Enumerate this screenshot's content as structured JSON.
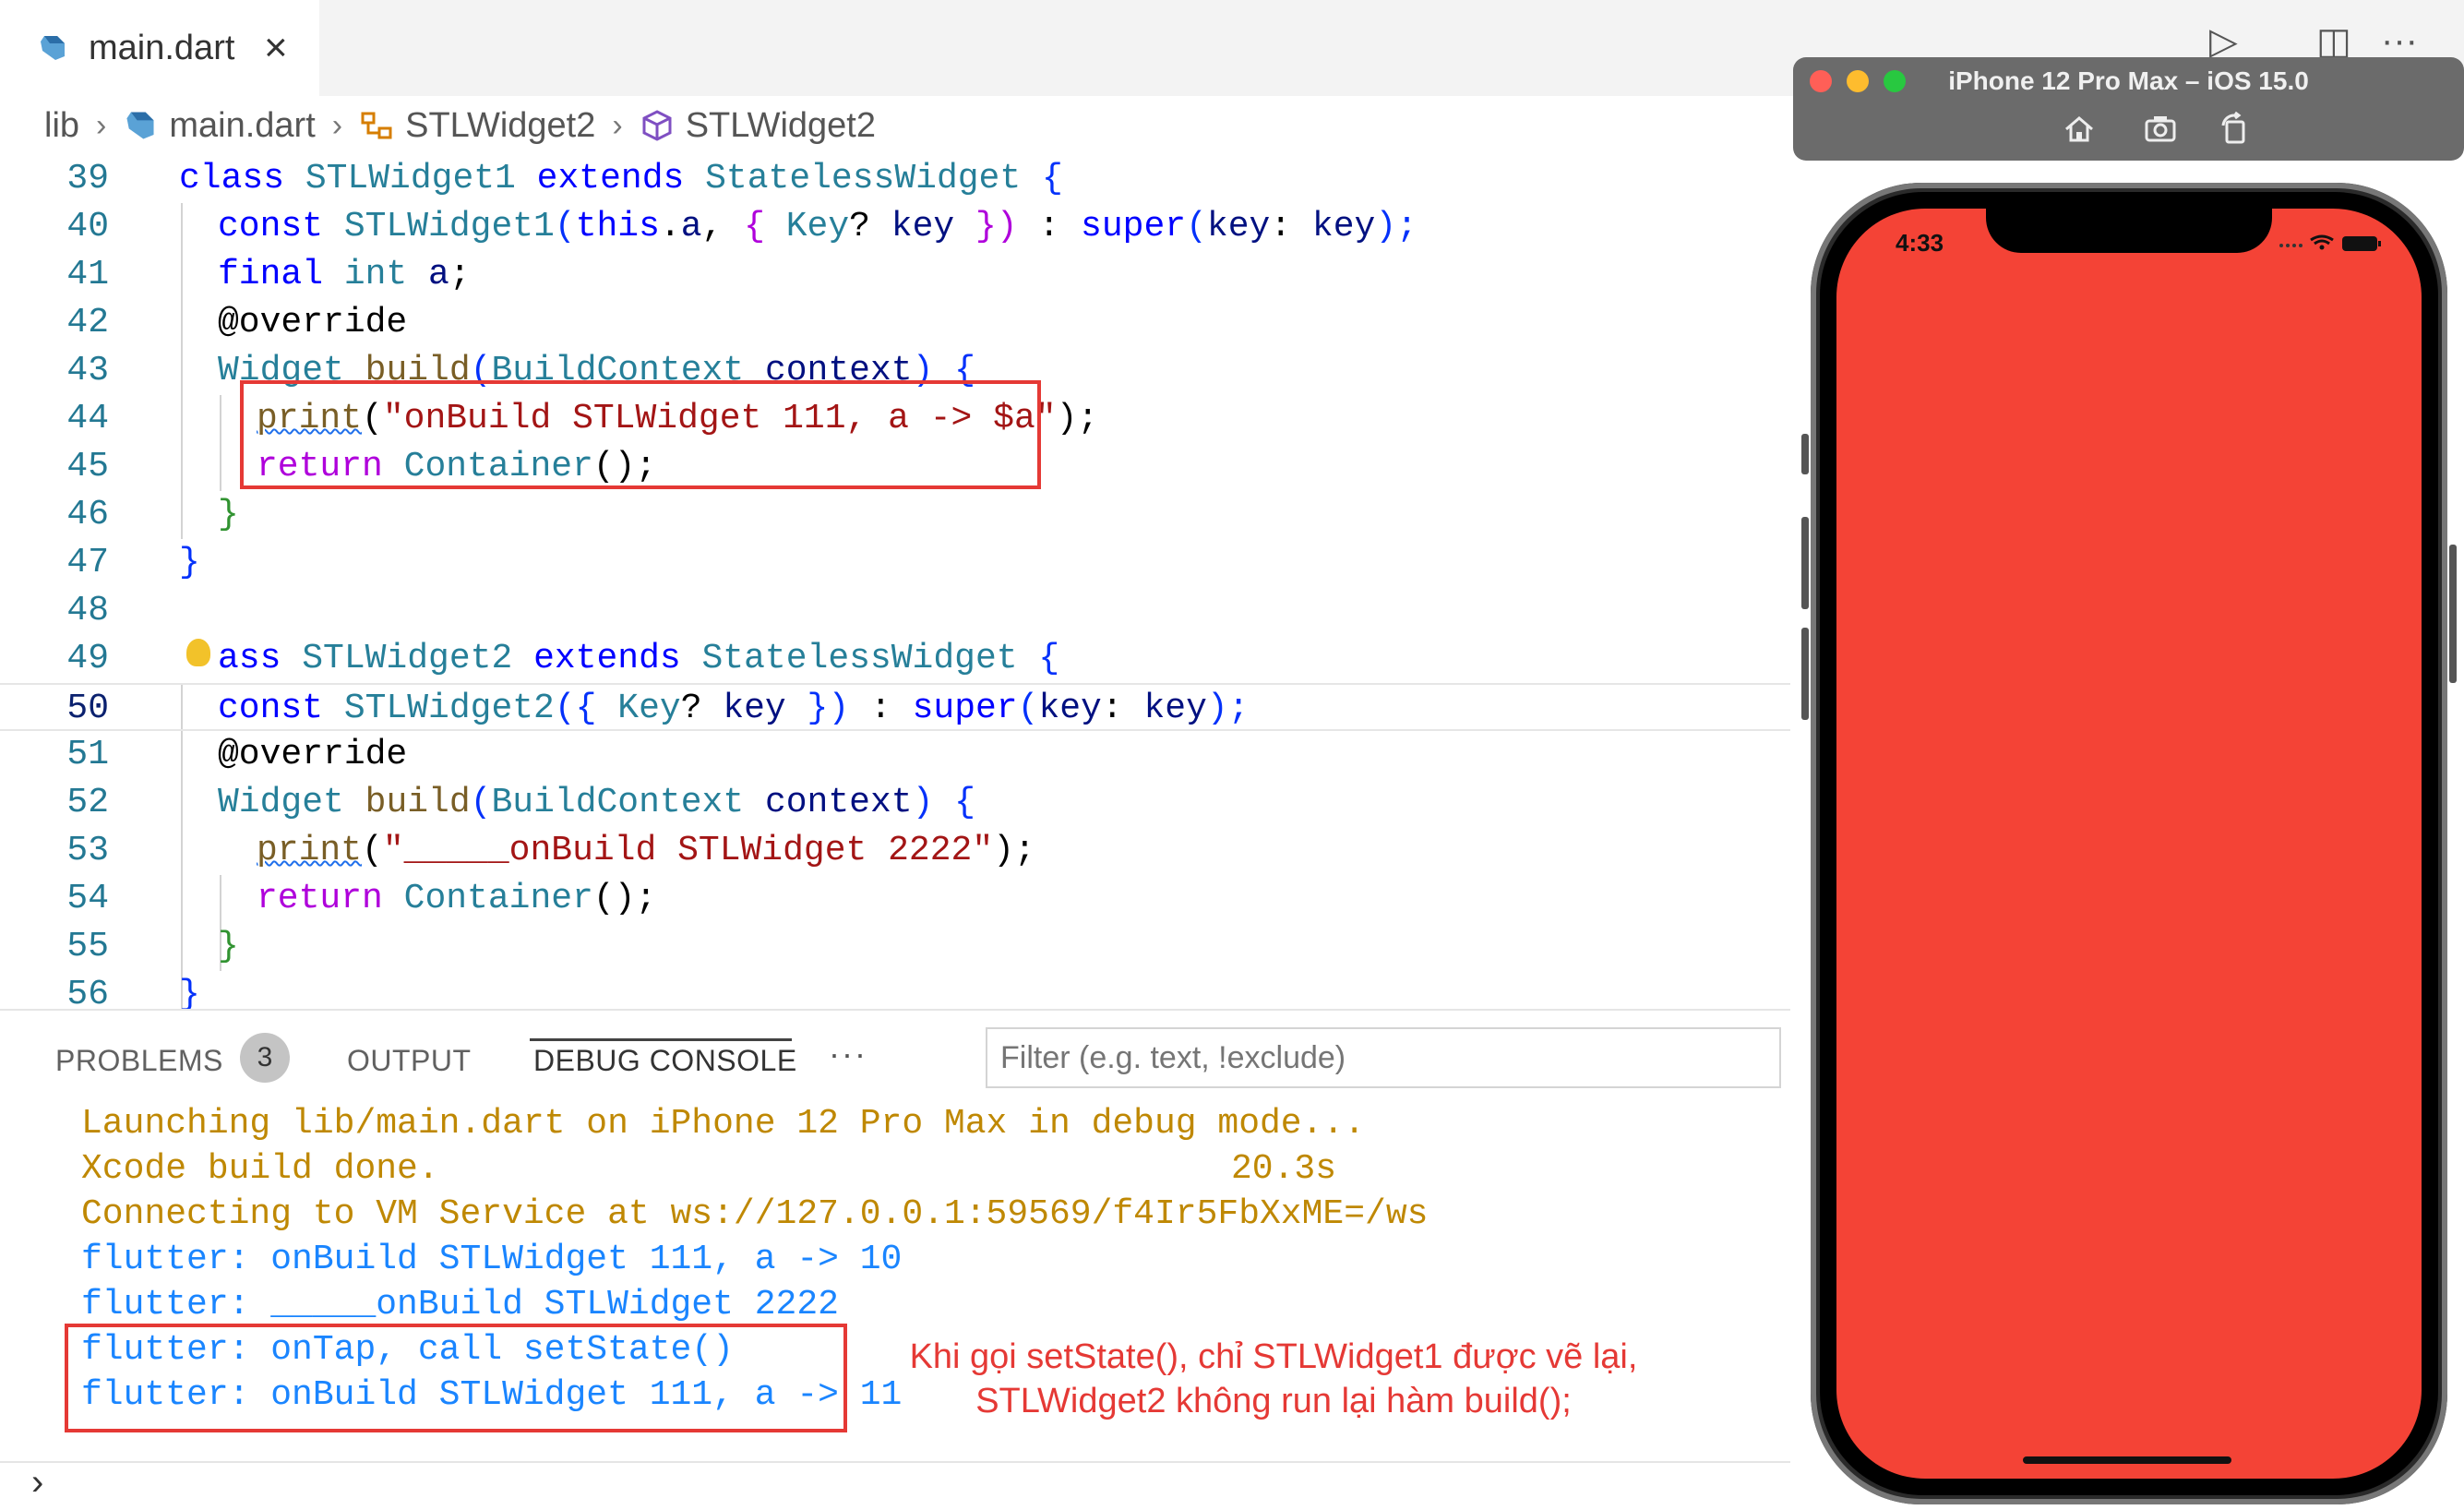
{
  "tab": {
    "label": "main.dart",
    "close": "×"
  },
  "top_actions": {
    "run": "▷",
    "split": "◫",
    "more": "···"
  },
  "breadcrumb": {
    "items": [
      "lib",
      "main.dart",
      "STLWidget2",
      "STLWidget2"
    ],
    "sep": "›"
  },
  "editor": {
    "line_numbers": [
      "39",
      "40",
      "41",
      "42",
      "43",
      "44",
      "45",
      "46",
      "47",
      "48",
      "49",
      "50",
      "51",
      "52",
      "53",
      "54",
      "55",
      "56"
    ],
    "current_line": "50",
    "lines": {
      "l39": {
        "a": "class ",
        "b": "STLWidget1",
        "c": " extends ",
        "d": "StatelessWidget",
        "e": " {"
      },
      "l40": {
        "a": "const ",
        "b": "STLWidget1",
        "c": "(",
        "d": "this",
        "e": ".",
        "f": "a",
        "g": ", ",
        "h": "{ ",
        "i": "Key",
        "j": "? ",
        "k": "key",
        "l": " })",
        "m": " : ",
        "n": "super",
        "o": "(",
        "p": "key",
        "q": ": ",
        "r": "key",
        "s": ");"
      },
      "l41": {
        "a": "final ",
        "b": "int ",
        "c": "a",
        "d": ";"
      },
      "l42": {
        "a": "@override"
      },
      "l43": {
        "a": "Widget ",
        "b": "build",
        "c": "(",
        "d": "BuildContext ",
        "e": "context",
        "f": ") {"
      },
      "l44": {
        "a": "print",
        "b": "(",
        "c": "\"onBuild STLWidget 111, a -> $a\"",
        "d": ");"
      },
      "l45": {
        "a": "return ",
        "b": "Container",
        "c": "();"
      },
      "l46": {
        "a": "}"
      },
      "l47": {
        "a": "}"
      },
      "l49": {
        "a": "ass ",
        "b": "STLWidget2",
        "c": " extends ",
        "d": "StatelessWidget",
        "e": " {"
      },
      "l50": {
        "a": "const ",
        "b": "STLWidget2",
        "c": "({ ",
        "d": "Key",
        "e": "? ",
        "f": "key",
        "g": " })",
        "h": " : ",
        "i": "super",
        "j": "(",
        "k": "key",
        "l": ": ",
        "m": "key",
        "n": ");"
      },
      "l51": {
        "a": "@override"
      },
      "l52": {
        "a": "Widget ",
        "b": "build",
        "c": "(",
        "d": "BuildContext ",
        "e": "context",
        "f": ") {"
      },
      "l53": {
        "a": "print",
        "b": "(",
        "c": "\"_____onBuild STLWidget 2222\"",
        "d": ");"
      },
      "l54": {
        "a": "return ",
        "b": "Container",
        "c": "();"
      },
      "l55": {
        "a": "}"
      },
      "l56": {
        "a": "}"
      }
    }
  },
  "panel": {
    "tabs": [
      "PROBLEMS",
      "OUTPUT",
      "DEBUG CONSOLE"
    ],
    "problems_count": "3",
    "more": "···",
    "filter_placeholder": "Filter (e.g. text, !exclude)",
    "console": [
      "Launching lib/main.dart on iPhone 12 Pro Max in debug mode...",
      "Xcode build done.",
      "20.3s",
      "Connecting to VM Service at ws://127.0.0.1:59569/f4Ir5FbXxME=/ws",
      "flutter: onBuild STLWidget 111, a -> 10",
      "flutter: _____onBuild STLWidget 2222",
      "flutter: onTap, call setState()",
      "flutter: onBuild STLWidget 111, a -> 11"
    ],
    "prompt": "›",
    "annotation": [
      "Khi gọi setState(), chỉ STLWidget1 được vẽ lại,",
      "STLWidget2 không run lại hàm build();"
    ]
  },
  "simulator": {
    "title": "iPhone 12 Pro Max – iOS 15.0",
    "time": "4:33",
    "screen_color": "#f44336"
  },
  "colors": {
    "highlight_box": "#e53935",
    "console_orange": "#bf8803",
    "console_blue": "#1a85ff"
  }
}
